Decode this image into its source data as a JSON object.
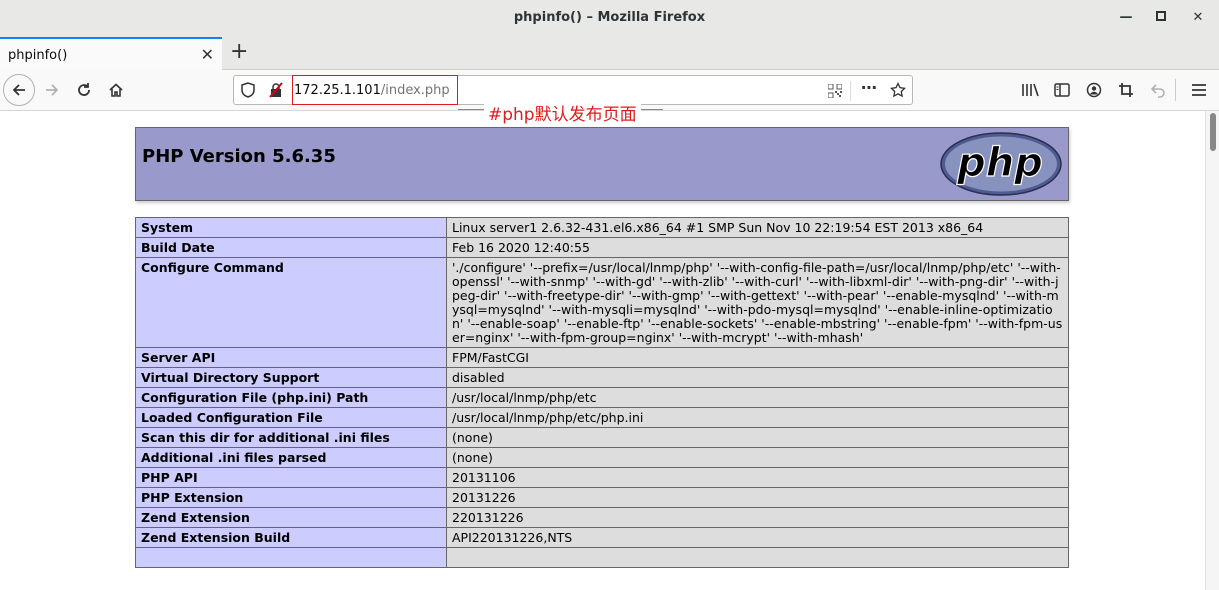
{
  "window": {
    "title": "phpinfo() – Mozilla Firefox"
  },
  "tab": {
    "label": "phpinfo()"
  },
  "url": {
    "host": "172.25.1.101",
    "path": "/index.php"
  },
  "annotation": "#php默认发布页面",
  "page": {
    "heading": "PHP Version 5.6.35",
    "logo_text": "php",
    "rows": [
      {
        "key": "System",
        "value": "Linux server1 2.6.32-431.el6.x86_64 #1 SMP Sun Nov 10 22:19:54 EST 2013 x86_64"
      },
      {
        "key": "Build Date",
        "value": "Feb 16 2020 12:40:55"
      },
      {
        "key": "Configure Command",
        "value": "'./configure' '--prefix=/usr/local/lnmp/php' '--with-config-file-path=/usr/local/lnmp/php/etc' '--with-openssl' '--with-snmp' '--with-gd' '--with-zlib' '--with-curl' '--with-libxml-dir' '--with-png-dir' '--with-jpeg-dir' '--with-freetype-dir' '--with-gmp' '--with-gettext' '--with-pear' '--enable-mysqlnd' '--with-mysql=mysqlnd' '--with-mysqli=mysqlnd' '--with-pdo-mysql=mysqlnd' '--enable-inline-optimization' '--enable-soap' '--enable-ftp' '--enable-sockets' '--enable-mbstring' '--enable-fpm' '--with-fpm-user=nginx' '--with-fpm-group=nginx' '--with-mcrypt' '--with-mhash'"
      },
      {
        "key": "Server API",
        "value": "FPM/FastCGI"
      },
      {
        "key": "Virtual Directory Support",
        "value": "disabled"
      },
      {
        "key": "Configuration File (php.ini) Path",
        "value": "/usr/local/lnmp/php/etc"
      },
      {
        "key": "Loaded Configuration File",
        "value": "/usr/local/lnmp/php/etc/php.ini"
      },
      {
        "key": "Scan this dir for additional .ini files",
        "value": "(none)"
      },
      {
        "key": "Additional .ini files parsed",
        "value": "(none)"
      },
      {
        "key": "PHP API",
        "value": "20131106"
      },
      {
        "key": "PHP Extension",
        "value": "20131226"
      },
      {
        "key": "Zend Extension",
        "value": "220131226"
      },
      {
        "key": "Zend Extension Build",
        "value": "API220131226,NTS"
      },
      {
        "key": "",
        "value": ""
      }
    ]
  },
  "colors": {
    "header_bg": "#9999cc",
    "key_bg": "#ccccff",
    "value_bg": "#dddddd",
    "annotation": "#e01b1b"
  }
}
